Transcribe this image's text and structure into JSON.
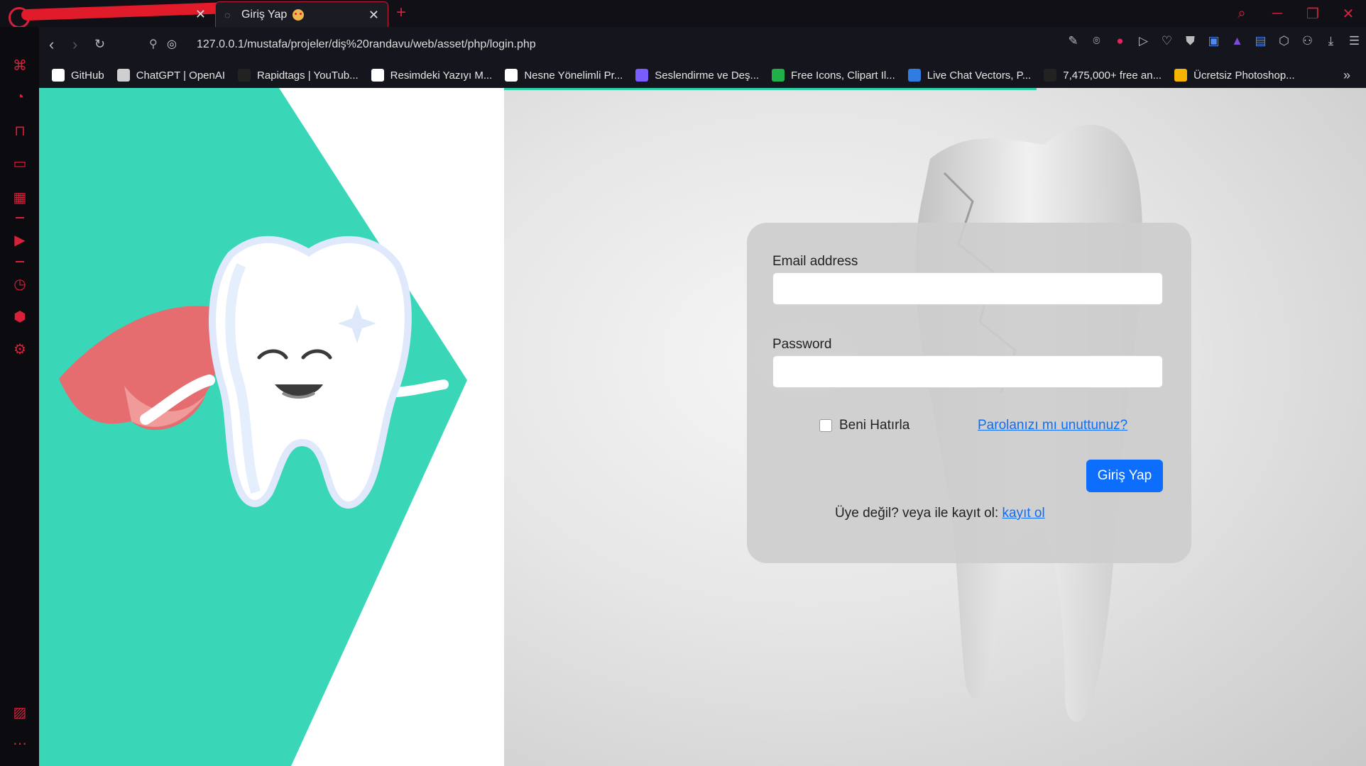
{
  "browser": {
    "tabs": [
      {
        "label": "",
        "active": false
      },
      {
        "label": "Giriş Yap",
        "active": true
      }
    ],
    "url": "127.0.0.1/mustafa/projeler/diş%20randavu/web/asset/php/login.php",
    "accent_color": "#d8203a",
    "bookmarks": [
      {
        "label": "GitHub",
        "icon": "github-icon",
        "color": "#ffffff"
      },
      {
        "label": "ChatGPT | OpenAI",
        "icon": "chatgpt-icon",
        "color": "#cfcfcf"
      },
      {
        "label": "Rapidtags | YouTub...",
        "icon": "rapidtags-icon",
        "color": "#222222"
      },
      {
        "label": "Resimdeki Yazıyı M...",
        "icon": "document-icon",
        "color": "#ffffff"
      },
      {
        "label": "Nesne Yönelimli Pr...",
        "icon": "medium-icon",
        "color": "#ffffff"
      },
      {
        "label": "Seslendirme ve Deş...",
        "icon": "audio-bars-icon",
        "color": "#7b5cff"
      },
      {
        "label": "Free Icons, Clipart Il...",
        "icon": "freepik-icon",
        "color": "#1fb04a"
      },
      {
        "label": "Live Chat Vectors, P...",
        "icon": "livechat-icon",
        "color": "#2f7de0"
      },
      {
        "label": "7,475,000+ free an...",
        "icon": "flaticon-icon",
        "color": "#222222"
      },
      {
        "label": "Ücretsiz Photoshop...",
        "icon": "f-logo-icon",
        "color": "#f6b300"
      }
    ]
  },
  "login": {
    "email_label": "Email address",
    "email_value": "",
    "password_label": "Password",
    "password_value": "",
    "remember_label": "Beni Hatırla",
    "remember_checked": false,
    "forgot_link": "Parolanızı mı unuttunuz?",
    "submit_label": "Giriş Yap",
    "register_text": "Üye değil? veya ile kayıt ol: ",
    "register_link": "kayıt ol"
  },
  "colors": {
    "brand_teal": "#39d6b8",
    "primary_button": "#0d6efd",
    "cape": "#e56c6f"
  }
}
